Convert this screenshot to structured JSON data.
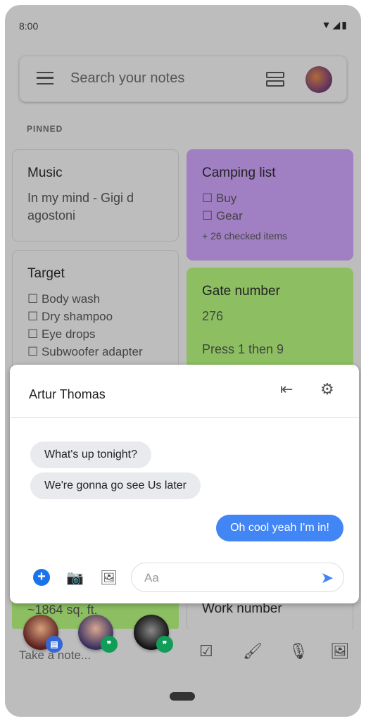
{
  "status": {
    "time": "8:00",
    "icons": "▼◢▮"
  },
  "search": {
    "placeholder": "Search your notes"
  },
  "section_label": "PINNED",
  "notes": {
    "music": {
      "title": "Music",
      "body": "In my mind - Gigi d agostoni"
    },
    "camping": {
      "title": "Camping list",
      "items": [
        "☐ Buy",
        "☐ Gear"
      ],
      "checked": "+ 26 checked items",
      "color": "#a07fc2"
    },
    "target": {
      "title": "Target",
      "items": [
        "☐ Body wash",
        "☐ Dry shampoo",
        "☐ Eye drops",
        "☐ Subwoofer adapter"
      ]
    },
    "gate": {
      "title": "Gate number",
      "line1": "276",
      "line2": "Press 1 then 9",
      "color": "#8dbf62"
    },
    "house": {
      "body": "~1864 sq. ft."
    },
    "work": {
      "title": "Work number"
    }
  },
  "chat": {
    "contact": "Artur Thomas",
    "messages": [
      {
        "from": "them",
        "text": "What's up tonight?"
      },
      {
        "from": "them",
        "text": "We're gonna go see Us later"
      },
      {
        "from": "me",
        "text": "Oh cool yeah I'm in!"
      }
    ],
    "input_placeholder": "Aa",
    "accent": "#4285f4"
  },
  "bottom_bar": {
    "placeholder": "Take a note..."
  }
}
